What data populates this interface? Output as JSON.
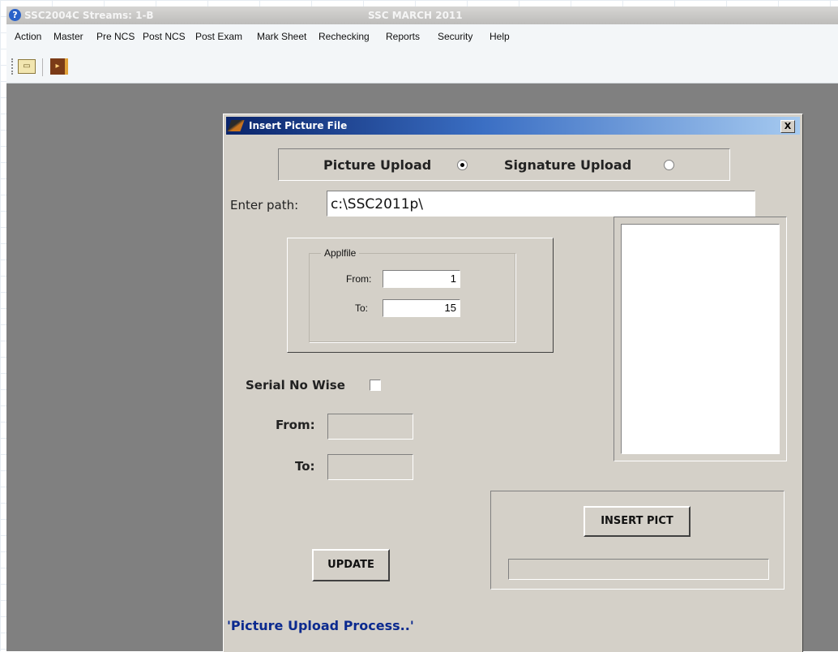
{
  "app": {
    "title_left": "SSC2004C Streams: 1-B",
    "title_center": "SSC MARCH 2011"
  },
  "menu": [
    "Action",
    "Master",
    "Pre NCS",
    "Post NCS",
    "Post Exam",
    "Mark Sheet",
    "Rechecking",
    "Reports",
    "Security",
    "Help"
  ],
  "toolbar": {
    "open_icon": "open-folder-icon",
    "exit_icon": "exit-door-icon"
  },
  "dialog": {
    "title": "Insert Picture File",
    "close_label": "X",
    "upload_type": {
      "picture_label": "Picture Upload",
      "signature_label": "Signature Upload",
      "selected": "picture"
    },
    "path": {
      "label": "Enter path:",
      "value": "c:\\SSC2011p\\"
    },
    "applfile": {
      "legend": "Applfile",
      "from_label": "From:",
      "from_value": "1",
      "to_label": "To:",
      "to_value": "15"
    },
    "serial": {
      "label": "Serial No Wise",
      "checked": false,
      "from_label": "From:",
      "to_label": "To:"
    },
    "insert_button": "INSERT PICT",
    "update_button": "UPDATE",
    "status": "'Picture Upload Process..'"
  },
  "colors": {
    "dialog_bg": "#d4d0c8",
    "workspace_bg": "#808080",
    "status_text": "#0b2a8f"
  }
}
